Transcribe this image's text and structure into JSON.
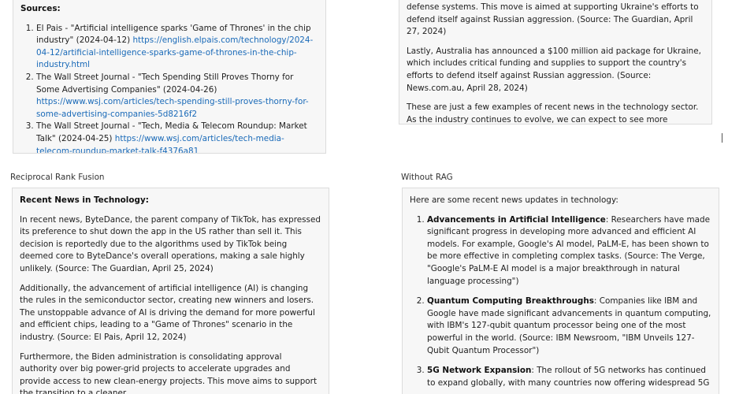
{
  "top_left": {
    "sources_title": "Sources:",
    "sources": [
      {
        "text": "El Pais - \"Artificial intelligence sparks 'Game of Thrones' in the chip industry\" (2024-04-12) ",
        "url": "https://english.elpais.com/technology/2024-04-12/artificial-intelligence-sparks-game-of-thrones-in-the-chip-industry.html"
      },
      {
        "text": "The Wall Street Journal - \"Tech Spending Still Proves Thorny for Some Advertising Companies\" (2024-04-26) ",
        "url": "https://www.wsj.com/articles/tech-spending-still-proves-thorny-for-some-advertising-companies-5d8216f2"
      },
      {
        "text": "The Wall Street Journal - \"Tech, Media & Telecom Roundup: Market Talk\" (2024-04-25) ",
        "url": "https://www.wsj.com/articles/tech-media-telecom-roundup-market-talk-f4376a81"
      }
    ]
  },
  "top_right": {
    "paragraphs": [
      "defense systems. This move is aimed at supporting Ukraine's efforts to defend itself against Russian aggression. (Source: The Guardian, April 27, 2024)",
      "Lastly, Australia has announced a $100 million aid package for Ukraine, which includes critical funding and supplies to support the country's efforts to defend itself against Russian aggression. (Source: News.com.au, April 28, 2024)",
      "These are just a few examples of recent news in the technology sector. As the industry continues to evolve, we can expect to see more developments and innovations in the coming months and years."
    ]
  },
  "bottom_left": {
    "label": "Reciprocal Rank Fusion",
    "heading": "Recent News in Technology:",
    "paragraphs": [
      "In recent news, ByteDance, the parent company of TikTok, has expressed its preference to shut down the app in the US rather than sell it. This decision is reportedly due to the algorithms used by TikTok being deemed core to ByteDance's overall operations, making a sale highly unlikely. (Source: The Guardian, April 25, 2024)",
      "Additionally, the advancement of artificial intelligence (AI) is changing the rules in the semiconductor sector, creating new winners and losers. The unstoppable advance of AI is driving the demand for more powerful and efficient chips, leading to a \"Game of Thrones\" scenario in the industry. (Source: El Pais, April 12, 2024)",
      "Furthermore, the Biden administration is consolidating approval authority over big power-grid projects to accelerate upgrades and provide access to new clean-energy projects. This move aims to support the transition to a cleaner"
    ]
  },
  "bottom_right": {
    "label": "Without RAG",
    "intro": "Here are some recent news updates in technology:",
    "items": [
      {
        "title": "Advancements in Artificial Intelligence",
        "body": ": Researchers have made significant progress in developing more advanced and efficient AI models. For example, Google's AI model, PaLM-E, has been shown to be more effective in completing complex tasks. (Source: The Verge, \"Google's PaLM-E AI model is a major breakthrough in natural language processing\")"
      },
      {
        "title": "Quantum Computing Breakthroughs",
        "body": ": Companies like IBM and Google have made significant advancements in quantum computing, with IBM's 127-qubit quantum processor being one of the most powerful in the world. (Source: IBM Newsroom, \"IBM Unveils 127-Qubit Quantum Processor\")"
      },
      {
        "title": "5G Network Expansion",
        "body": ": The rollout of 5G networks has continued to expand globally, with many countries now offering widespread 5G"
      }
    ]
  }
}
